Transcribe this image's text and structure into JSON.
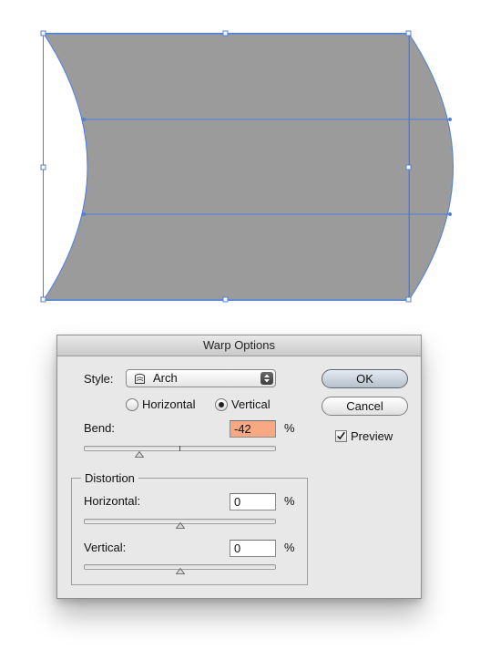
{
  "dialog": {
    "title": "Warp Options",
    "style_label": "Style:",
    "style_value": "Arch",
    "orientation": {
      "horizontal_label": "Horizontal",
      "vertical_label": "Vertical",
      "selected": "vertical"
    },
    "bend": {
      "label": "Bend:",
      "value": "-42",
      "unit": "%",
      "percent": -42
    },
    "distortion": {
      "group_title": "Distortion",
      "horizontal": {
        "label": "Horizontal:",
        "value": "0",
        "unit": "%",
        "percent": 0
      },
      "vertical": {
        "label": "Vertical:",
        "value": "0",
        "unit": "%",
        "percent": 0
      }
    },
    "buttons": {
      "ok": "OK",
      "cancel": "Cancel"
    },
    "preview": {
      "label": "Preview",
      "checked": true
    }
  },
  "artwork": {
    "fill_color": "#9b9b9b",
    "selection_color": "#4a7fe0",
    "shape": "arch-warped rectangle"
  }
}
